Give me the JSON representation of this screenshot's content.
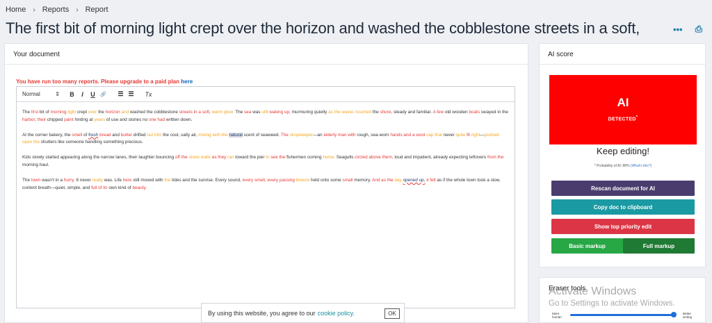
{
  "breadcrumb": {
    "home": "Home",
    "reports": "Reports",
    "current": "Report",
    "separator": "›"
  },
  "page_title": "The first bit of morning light crept over the horizon and washed the cobblestone streets in a soft,",
  "actions": {
    "more": "•••",
    "print": "⎙"
  },
  "document_panel": {
    "title": "Your document",
    "upgrade_text": "You have run too many reports. Please upgrade to a paid plan",
    "upgrade_link": "here"
  },
  "toolbar": {
    "format": "Normal",
    "format_arrow": "⇕",
    "bold": "B",
    "italic": "I",
    "underline": "U",
    "link": "🔗",
    "ordered_list": "☰",
    "bullet_list": "☰",
    "clear": "Tx"
  },
  "paragraphs": [
    "The first bit of morning light crept over the horizon and washed the cobblestone streets in a soft, warm glow. The sea was still waking up, murmuring quietly as the waves touched the shore, steady and familiar. A few old wooden boats swayed in the harbor, their chipped paint hinting at years of use and stories no one had written down.",
    "At the corner bakery, the smell of fresh bread and butter drifted out into the cool, salty air, mixing with the natural scent of seaweed. The shopkeeper—an elderly man with rough, sea-worn hands and a wool cap that never quite fit right—pushed open the shutters like someone handling something precious.",
    "Kids slowly started appearing along the narrow lanes, their laughter bouncing off the stone walls as they ran toward the pier to see the fishermen coming home. Seagulls circled above them, loud and impatient, already expecting leftovers from the morning haul.",
    "The town wasn't in a hurry. It never really was. Life here still moved with the tides and the sunrise. Every sound, every smell, every passing breeze held onto some small memory. And as the day opened up, it felt as if the whole town took a slow, content breath—quiet, simple, and full of its own kind of beauty."
  ],
  "score_panel": {
    "title": "AI score",
    "ai_label": "AI",
    "detected_label": "DETECTED",
    "detected_mark": "*",
    "status": "Keep editing!",
    "probability_text": "* Probability of AI: 88%",
    "probability_link": "(What's this?)",
    "colors": {
      "detected": "#ff0000"
    }
  },
  "buttons": {
    "rescan": "Rescan document for AI",
    "copy": "Copy doc to clipboard",
    "priority": "Show top priority edit",
    "basic": "Basic markup",
    "full": "Full markup"
  },
  "eraser": {
    "title": "Eraser tools",
    "left_label_1": "More",
    "left_label_2": "human",
    "right_label_1": "Better",
    "right_label_2": "writing",
    "slider_value": 0.98
  },
  "watermark": {
    "line1": "Activate Windows",
    "line2": "Go to Settings to activate Windows."
  },
  "cookie": {
    "text": "By using this website, you agree to our",
    "link": "cookie policy.",
    "ok": "OK"
  }
}
